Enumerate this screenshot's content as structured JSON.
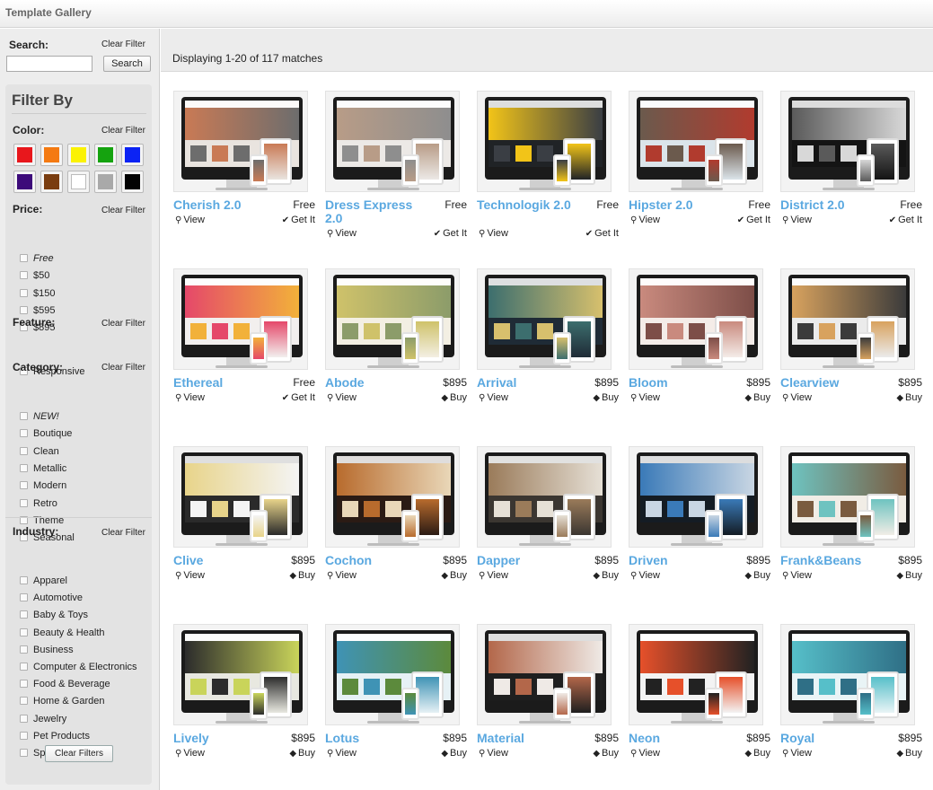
{
  "window": {
    "title": "Template Gallery"
  },
  "search": {
    "label": "Search:",
    "clear": "Clear Filter",
    "button": "Search",
    "value": "",
    "placeholder": ""
  },
  "filter": {
    "title": "Filter By",
    "color": {
      "label": "Color:",
      "clear": "Clear Filter",
      "swatches": [
        "#e8171c",
        "#f47a12",
        "#fbf203",
        "#15a30f",
        "#0b23f4",
        "#3d0b7a",
        "#7a3d10",
        "#ffffff",
        "#a9a9a9",
        "#030303"
      ]
    },
    "price": {
      "label": "Price:",
      "clear": "Clear Filter",
      "options": [
        "Free",
        "$50",
        "$150",
        "$595",
        "$895"
      ]
    },
    "feature": {
      "label": "Feature:",
      "clear": "Clear Filter",
      "options": [
        "Responsive"
      ]
    },
    "category": {
      "label": "Category:",
      "clear": "Clear Filter",
      "options": [
        "NEW!",
        "Boutique",
        "Clean",
        "Metallic",
        "Modern",
        "Retro",
        "Theme",
        "Seasonal"
      ]
    },
    "industry": {
      "label": "Industry:",
      "clear": "Clear Filter",
      "options": [
        "Apparel",
        "Automotive",
        "Baby & Toys",
        "Beauty & Health",
        "Business",
        "Computer & Electronics",
        "Food & Beverage",
        "Home & Garden",
        "Jewelry",
        "Pet Products",
        "Sports & Games"
      ]
    },
    "clear_all": "Clear Filters"
  },
  "results": {
    "summary": "Displaying 1-20 of 117 matches",
    "view_label": "View",
    "templates": [
      {
        "name": "Cherish 2.0",
        "price": "Free",
        "action": "Get It",
        "colors": [
          "#e9e4df",
          "#c97a55",
          "#6d6d6d"
        ]
      },
      {
        "name": "Dress Express 2.0",
        "price": "Free",
        "action": "Get It",
        "colors": [
          "#ece9e6",
          "#b89c87",
          "#8e8e8e"
        ]
      },
      {
        "name": "Technologik 2.0",
        "price": "Free",
        "action": "Get It",
        "colors": [
          "#202326",
          "#f2c418",
          "#3a3e44"
        ]
      },
      {
        "name": "Hipster 2.0",
        "price": "Free",
        "action": "Get It",
        "colors": [
          "#dbe4ea",
          "#6b5a4d",
          "#b13b2e"
        ]
      },
      {
        "name": "District 2.0",
        "price": "Free",
        "action": "Get It",
        "colors": [
          "#141414",
          "#5a5a5a",
          "#d8d8d8"
        ]
      },
      {
        "name": "Ethereal",
        "price": "Free",
        "action": "Get It",
        "colors": [
          "#f2efee",
          "#e5486a",
          "#f2b13a"
        ]
      },
      {
        "name": "Abode",
        "price": "$895",
        "action": "Buy",
        "colors": [
          "#f3efe3",
          "#cfc26a",
          "#8c9c6a"
        ]
      },
      {
        "name": "Arrival",
        "price": "$895",
        "action": "Buy",
        "colors": [
          "#1f2b36",
          "#3c6e6e",
          "#d7c06d"
        ]
      },
      {
        "name": "Bloom",
        "price": "$895",
        "action": "Buy",
        "colors": [
          "#f4ece8",
          "#c98a7e",
          "#7d4e48"
        ]
      },
      {
        "name": "Clearview",
        "price": "$895",
        "action": "Buy",
        "colors": [
          "#ebebeb",
          "#d8a25e",
          "#3b3b3b"
        ]
      },
      {
        "name": "Clive",
        "price": "$895",
        "action": "Buy",
        "colors": [
          "#2a2a2a",
          "#e8d48a",
          "#f4f4f4"
        ]
      },
      {
        "name": "Cochon",
        "price": "$895",
        "action": "Buy",
        "colors": [
          "#2b1b14",
          "#b86b2d",
          "#e9d7b8"
        ]
      },
      {
        "name": "Dapper",
        "price": "$895",
        "action": "Buy",
        "colors": [
          "#3b3631",
          "#9a7b5a",
          "#e6e0d6"
        ]
      },
      {
        "name": "Driven",
        "price": "$895",
        "action": "Buy",
        "colors": [
          "#141c24",
          "#3a7ab8",
          "#c9d6e3"
        ]
      },
      {
        "name": "Frank&Beans",
        "price": "$895",
        "action": "Buy",
        "colors": [
          "#f1ede6",
          "#6ec3c0",
          "#7a5b3f"
        ]
      },
      {
        "name": "Lively",
        "price": "$895",
        "action": "Buy",
        "colors": [
          "#e8e8e0",
          "#2c2c2c",
          "#c9d45a"
        ]
      },
      {
        "name": "Lotus",
        "price": "$895",
        "action": "Buy",
        "colors": [
          "#e6f1f5",
          "#3f93b5",
          "#5c8a3c"
        ]
      },
      {
        "name": "Material",
        "price": "$895",
        "action": "Buy",
        "colors": [
          "#1f1f1f",
          "#b3674a",
          "#efeae6"
        ]
      },
      {
        "name": "Neon",
        "price": "$895",
        "action": "Buy",
        "colors": [
          "#f3f3f3",
          "#e6502a",
          "#222222"
        ]
      },
      {
        "name": "Royal",
        "price": "$895",
        "action": "Buy",
        "colors": [
          "#e9f4f6",
          "#56bfc9",
          "#2f6f86"
        ]
      }
    ]
  }
}
